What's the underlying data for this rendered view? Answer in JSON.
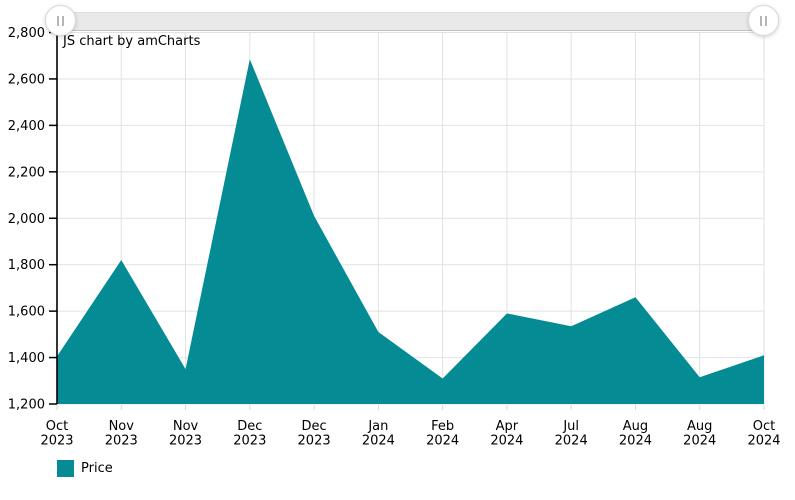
{
  "watermark": "JS chart by amCharts",
  "colors": {
    "series": "#058b94",
    "grid": "#e2e2e2",
    "axis": "#000000",
    "label": "#000000",
    "x_minor_tick": "#d6d6d6",
    "scrollbar_track": "#e9e9e9",
    "grip_background": "#ffffff",
    "grip_icon": "#b5b5b5"
  },
  "icons": {
    "scrollbar_grip": "drag-handle-vertical-bars"
  },
  "scrollbar": {
    "orientation": "horizontal",
    "range": "full"
  },
  "legend": {
    "position": "bottom",
    "items": [
      {
        "label": "Price",
        "color": "#058b94"
      }
    ]
  },
  "chart_data": {
    "type": "area",
    "title": "",
    "xlabel": "",
    "ylabel": "",
    "categories": [
      "Oct 2023",
      "Nov 2023",
      "Nov 2023",
      "Dec 2023",
      "Dec 2023",
      "Jan 2024",
      "Feb 2024",
      "Apr 2024",
      "Jul 2024",
      "Aug 2024",
      "Aug 2024",
      "Oct 2024"
    ],
    "series": [
      {
        "name": "Price",
        "color": "#058b94",
        "values": [
          1405,
          1820,
          1350,
          2685,
          2010,
          1510,
          1310,
          1590,
          1535,
          1660,
          1315,
          1410
        ]
      }
    ],
    "ylim": [
      1200,
      2800
    ],
    "yticks": [
      1200,
      1400,
      1600,
      1800,
      2000,
      2200,
      2400,
      2600,
      2800
    ],
    "grid": true,
    "legend_position": "bottom"
  }
}
